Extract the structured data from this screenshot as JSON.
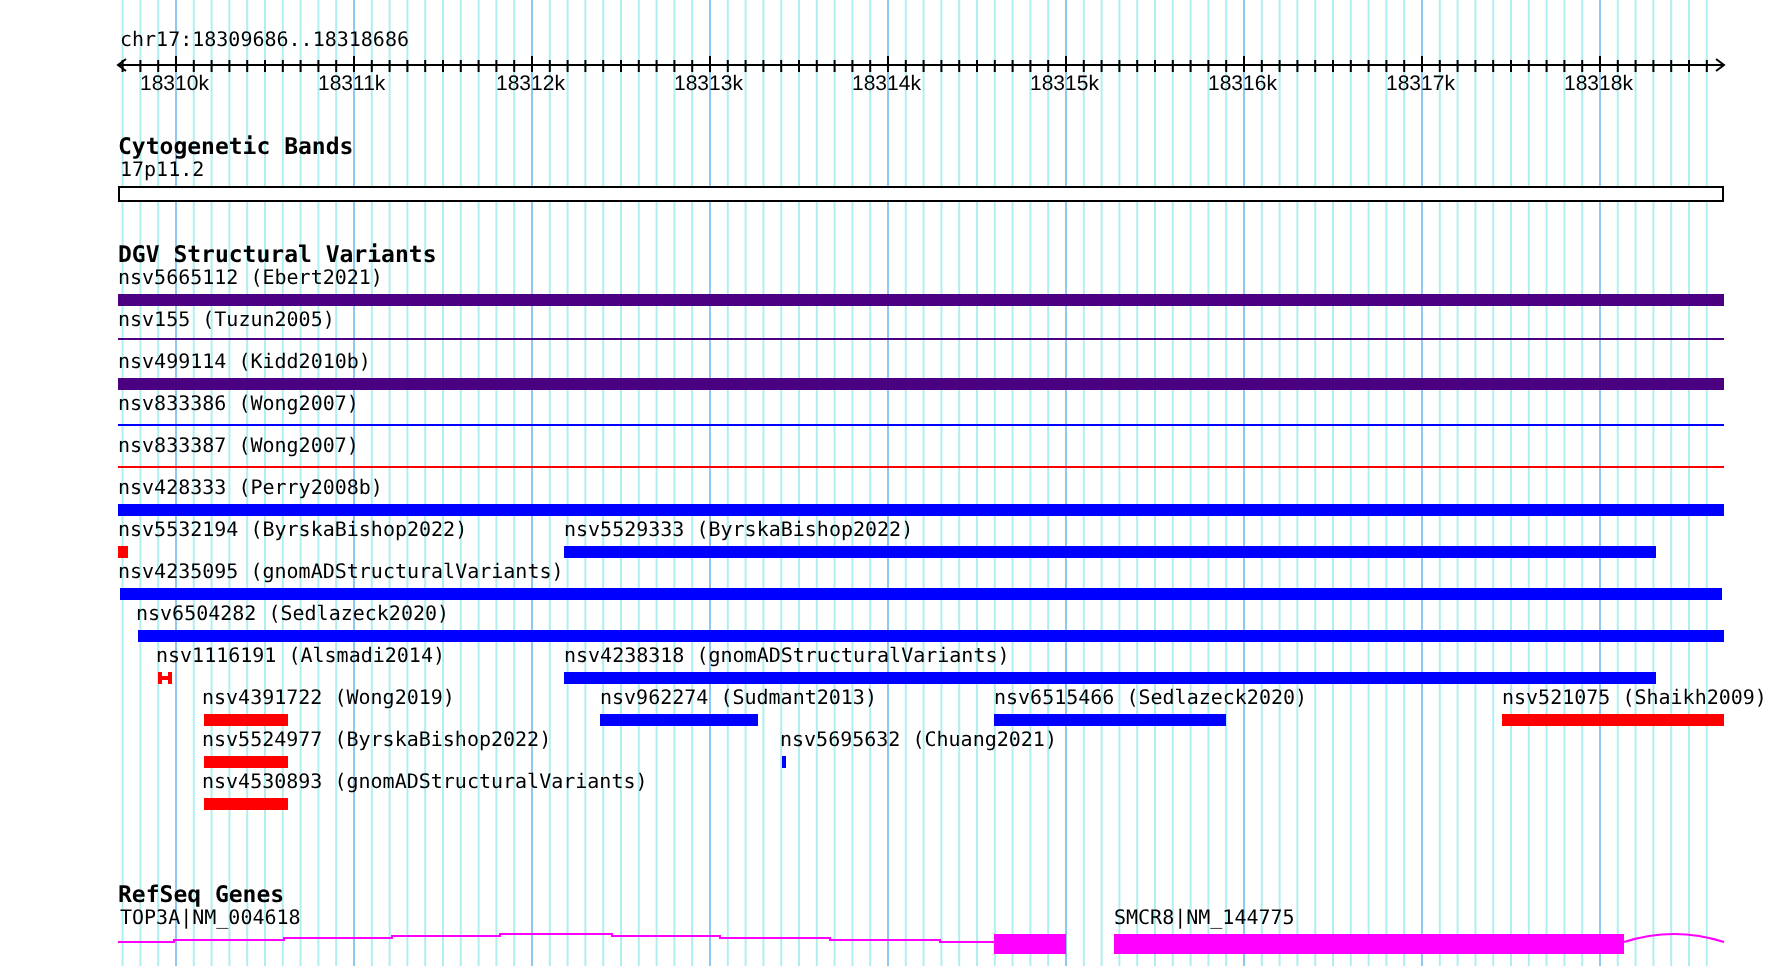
{
  "location": "chr17:18309686..18318686",
  "ruler": {
    "ticks": [
      "18310k",
      "18311k",
      "18312k",
      "18313k",
      "18314k",
      "18315k",
      "18316k",
      "18317k",
      "18318k"
    ]
  },
  "cytobands": {
    "title": "Cytogenetic Bands",
    "bands": [
      {
        "label": "17p11.2"
      }
    ]
  },
  "variants": {
    "title": "DGV Structural Variants",
    "features": [
      {
        "label": "nsv5665112 (Ebert2021)",
        "kind": "bar",
        "color": "#4b0082"
      },
      {
        "label": "nsv155 (Tuzun2005)",
        "kind": "line",
        "color": "#4b0082"
      },
      {
        "label": "nsv499114 (Kidd2010b)",
        "kind": "bar",
        "color": "#4b0082"
      },
      {
        "label": "nsv833386 (Wong2007)",
        "kind": "line",
        "color": "#0000ff"
      },
      {
        "label": "nsv833387 (Wong2007)",
        "kind": "line",
        "color": "#ff0000"
      },
      {
        "label": "nsv428333 (Perry2008b)",
        "kind": "bar",
        "color": "#0000ff"
      },
      {
        "label": "nsv5532194 (ByrskaBishop2022)",
        "kind": "bar",
        "color": "#ff0000"
      },
      {
        "label": "nsv5529333 (ByrskaBishop2022)",
        "kind": "bar",
        "color": "#0000ff"
      },
      {
        "label": "nsv4235095 (gnomADStructuralVariants)",
        "kind": "bar",
        "color": "#0000ff"
      },
      {
        "label": "nsv6504282 (Sedlazeck2020)",
        "kind": "bar",
        "color": "#0000ff"
      },
      {
        "label": "nsv1116191 (Alsmadi2014)",
        "kind": "marker",
        "color": "#ff0000"
      },
      {
        "label": "nsv4238318 (gnomADStructuralVariants)",
        "kind": "bar",
        "color": "#0000ff"
      },
      {
        "label": "nsv4391722 (Wong2019)",
        "kind": "bar",
        "color": "#ff0000"
      },
      {
        "label": "nsv962274 (Sudmant2013)",
        "kind": "bar",
        "color": "#0000ff"
      },
      {
        "label": "nsv6515466 (Sedlazeck2020)",
        "kind": "bar",
        "color": "#0000ff"
      },
      {
        "label": "nsv521075 (Shaikh2009)",
        "kind": "bar",
        "color": "#ff0000"
      },
      {
        "label": "nsv5524977 (ByrskaBishop2022)",
        "kind": "bar",
        "color": "#ff0000"
      },
      {
        "label": "nsv5695632 (Chuang2021)",
        "kind": "bar",
        "color": "#0000ff"
      },
      {
        "label": "nsv4530893 (gnomADStructuralVariants)",
        "kind": "bar",
        "color": "#ff0000"
      }
    ]
  },
  "genes": {
    "title": "RefSeq Genes",
    "features": [
      {
        "label": "TOP3A|NM_004618"
      },
      {
        "label": "SMCR8|NM_144775"
      }
    ]
  }
}
